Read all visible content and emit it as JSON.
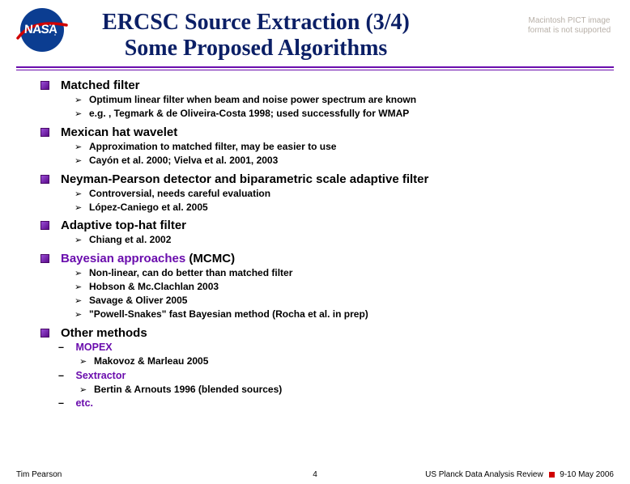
{
  "logo_text": "NASA",
  "pict_text": "Macintosh PICT image format is not supported",
  "title_line1": "ERCSC Source Extraction (3/4)",
  "title_line2": "Some Proposed Algorithms",
  "sections": {
    "s1": {
      "h": "Matched filter",
      "b1": "Optimum linear filter when beam and noise power spectrum are known",
      "b2": "e.g. , Tegmark & de Oliveira-Costa 1998; used successfully for WMAP"
    },
    "s2": {
      "h": "Mexican hat wavelet",
      "b1": "Approximation to matched filter, may be easier to use",
      "b2": "Cayón et al. 2000; Vielva et al. 2001, 2003"
    },
    "s3": {
      "h": "Neyman-Pearson detector and biparametric scale adaptive filter",
      "b1": "Controversial, needs careful evaluation",
      "b2": "López-Caniego et al. 2005"
    },
    "s4": {
      "h": "Adaptive top-hat filter",
      "b1": "Chiang et al. 2002"
    },
    "s5": {
      "h_pre": "Bayesian approaches",
      "h_post": " (MCMC)",
      "b1": "Non-linear, can do better than matched filter",
      "b2": "Hobson & Mc.Clachlan 2003",
      "b3": "Savage & Oliver 2005",
      "b4": "\"Powell-Snakes\" fast Bayesian method (Rocha et al. in prep)"
    },
    "s6": {
      "h": "Other methods",
      "d1": "MOPEX",
      "d1b": "Makovoz & Marleau 2005",
      "d2": "Sextractor",
      "d2b": "Bertin & Arnouts 1996 (blended sources)",
      "d3": "etc."
    }
  },
  "footer": {
    "left": "Tim Pearson",
    "center": "4",
    "right_a": "US Planck Data Analysis Review",
    "right_b": "9-10 May 2006"
  }
}
